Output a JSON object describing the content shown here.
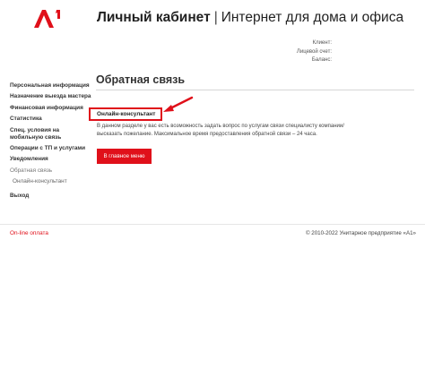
{
  "brand": {
    "logo_text": "A1",
    "accent": "#e0101a"
  },
  "header": {
    "title_strong": "Личный кабинет",
    "separator": "|",
    "title_rest": "Интернет для дома и офиса"
  },
  "account": {
    "client_label": "Клиент:",
    "account_label": "Лицевой счет:",
    "balance_label": "Баланс:"
  },
  "sidebar": {
    "items": [
      {
        "label": "Персональная информация"
      },
      {
        "label": "Назначение выезда мастера"
      },
      {
        "label": "Финансовая информация"
      },
      {
        "label": "Статистика"
      },
      {
        "label": "Спец. условия на мобильную связь"
      },
      {
        "label": "Операции с ТП и услугами"
      },
      {
        "label": "Уведомления"
      },
      {
        "label": "Обратная связь"
      },
      {
        "label": "Онлайн-консультант"
      },
      {
        "label": "Выход"
      }
    ]
  },
  "main": {
    "title": "Обратная связь",
    "section_label": "Онлайн-консультант",
    "description": "В данном разделе у вас есть возможность задать вопрос по услугам связи специалисту компании/высказать пожелание. Максимальное время предоставления обратной связи – 24 часа.",
    "home_button": "В главное меню"
  },
  "footer": {
    "online_payment": "On-line оплата",
    "copyright": "© 2010-2022 Унитарное предприятие «А1»"
  },
  "icons": {
    "annotation": "arrow-icon"
  }
}
